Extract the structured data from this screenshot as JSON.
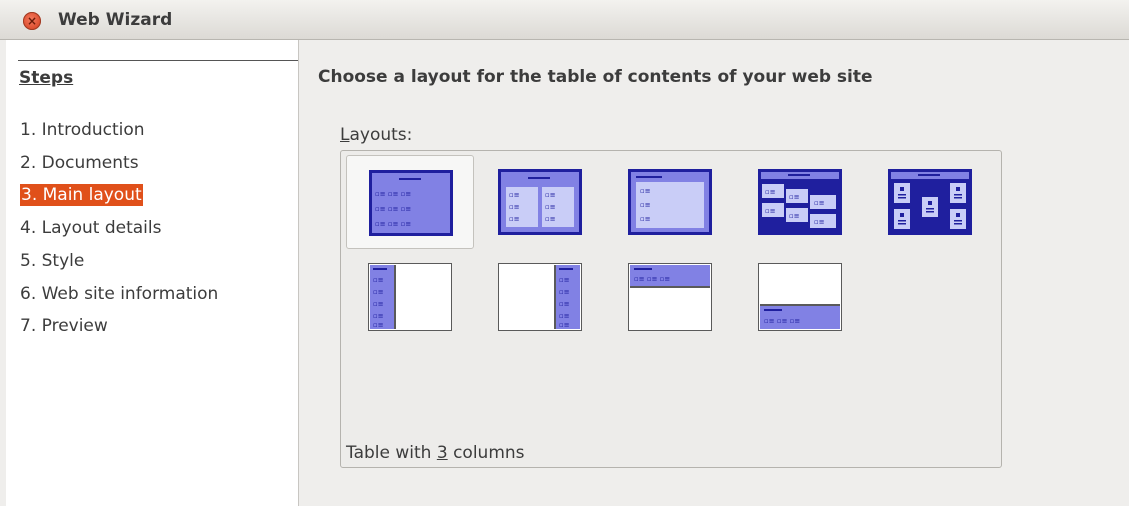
{
  "window": {
    "title": "Web Wizard"
  },
  "steps": {
    "heading": "Steps",
    "items": [
      {
        "label": "1. Introduction"
      },
      {
        "label": "2. Documents"
      },
      {
        "label": "3. Main layout",
        "active": true
      },
      {
        "label": "4. Layout details"
      },
      {
        "label": "5. Style"
      },
      {
        "label": "6. Web site information"
      },
      {
        "label": "7. Preview"
      }
    ]
  },
  "main": {
    "heading": "Choose a layout for the table of contents of your web site",
    "layouts_label_mnemonic": "L",
    "layouts_label_rest": "ayouts:",
    "layouts": [
      {
        "name": "table-3-columns",
        "selected": true
      },
      {
        "name": "table-2-columns"
      },
      {
        "name": "simple"
      },
      {
        "name": "diagonal"
      },
      {
        "name": "zigzag"
      },
      {
        "name": "frame-left"
      },
      {
        "name": "frame-right"
      },
      {
        "name": "frame-top"
      },
      {
        "name": "frame-bottom"
      }
    ],
    "description_before": "Table with ",
    "description_mnemonic": "3",
    "description_after": " columns"
  },
  "colors": {
    "accent": "#e0501a",
    "thumb_dark": "#1f1f9e",
    "thumb_mid": "#8181e4",
    "thumb_light": "#c9cdf7"
  }
}
